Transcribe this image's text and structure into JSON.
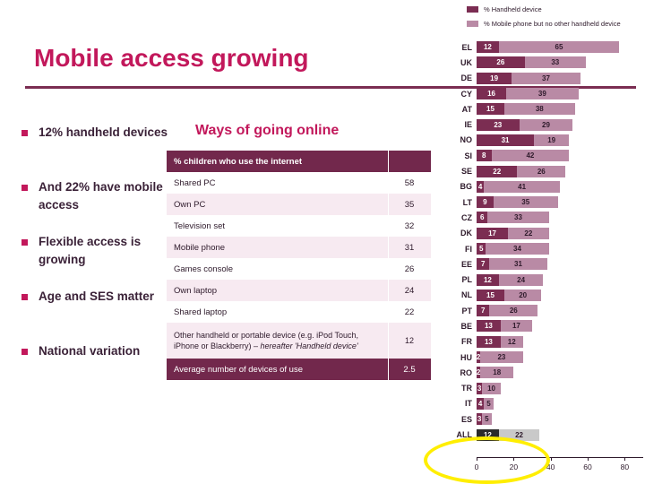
{
  "slide": {
    "title": "Mobile access growing",
    "title_color": "#C2185B",
    "rule_color": "#7B2D52"
  },
  "bullets": {
    "marker_color": "#C2185B",
    "items": [
      {
        "text": "12% handheld devices"
      },
      {
        "text": "And 22% have mobile access"
      },
      {
        "text": "Flexible access is growing"
      },
      {
        "text": "Age and SES matter"
      },
      {
        "text": "National variation"
      }
    ]
  },
  "ways_table": {
    "heading": "Ways of going online",
    "header_label": "% children who use the internet",
    "header_value": "",
    "rows": [
      {
        "label": "Shared PC",
        "value": "58"
      },
      {
        "label": "Own PC",
        "value": "35"
      },
      {
        "label": "Television set",
        "value": "32"
      },
      {
        "label": "Mobile phone",
        "value": "31"
      },
      {
        "label": "Games console",
        "value": "26"
      },
      {
        "label": "Own laptop",
        "value": "24"
      },
      {
        "label": "Shared laptop",
        "value": "22"
      },
      {
        "label": "Other handheld or portable device (e.g. iPod Touch, iPhone or Blackberry) – hereafter 'Handheld device'",
        "value": "12"
      }
    ],
    "total_row": {
      "label": "Average number of devices of use",
      "value": "2.5"
    }
  },
  "chart_data": {
    "type": "bar",
    "orientation": "horizontal",
    "stacked": true,
    "title": "",
    "xlabel": "",
    "ylabel": "",
    "xlim": [
      0,
      90
    ],
    "xticks": [
      "0",
      "20",
      "40",
      "60",
      "80"
    ],
    "grid": false,
    "legend_position": "top",
    "colors": {
      "handheld": "#7B2D52",
      "mobile_only": "#B98AA5",
      "all_handheld": "#2B2B2B",
      "all_mobile_only": "#C9C9C9"
    },
    "legend": [
      {
        "label": "% Handheld device",
        "color": "#7B2D52"
      },
      {
        "label": "% Mobile phone but no other handheld device",
        "color": "#B98AA5"
      }
    ],
    "series": [
      {
        "name": "% Handheld device",
        "values": [
          12,
          26,
          19,
          16,
          15,
          23,
          31,
          8,
          22,
          4,
          9,
          6,
          17,
          5,
          7,
          12,
          15,
          7,
          13,
          13,
          2,
          2,
          3,
          4,
          3,
          12
        ]
      },
      {
        "name": "% Mobile phone but no other handheld device",
        "values": [
          65,
          33,
          37,
          39,
          38,
          29,
          19,
          42,
          26,
          41,
          35,
          33,
          22,
          34,
          31,
          24,
          20,
          26,
          17,
          12,
          23,
          18,
          10,
          5,
          5,
          22
        ]
      }
    ],
    "categories": [
      "EL",
      "UK",
      "DE",
      "CY",
      "AT",
      "IE",
      "NO",
      "SI",
      "SE",
      "BG",
      "LT",
      "CZ",
      "DK",
      "FI",
      "EE",
      "PL",
      "NL",
      "PT",
      "BE",
      "FR",
      "HU",
      "RO",
      "TR",
      "IT",
      "ES",
      "ALL"
    ],
    "highlight_category": "ALL",
    "highlight_shape": "yellow-ellipse"
  }
}
